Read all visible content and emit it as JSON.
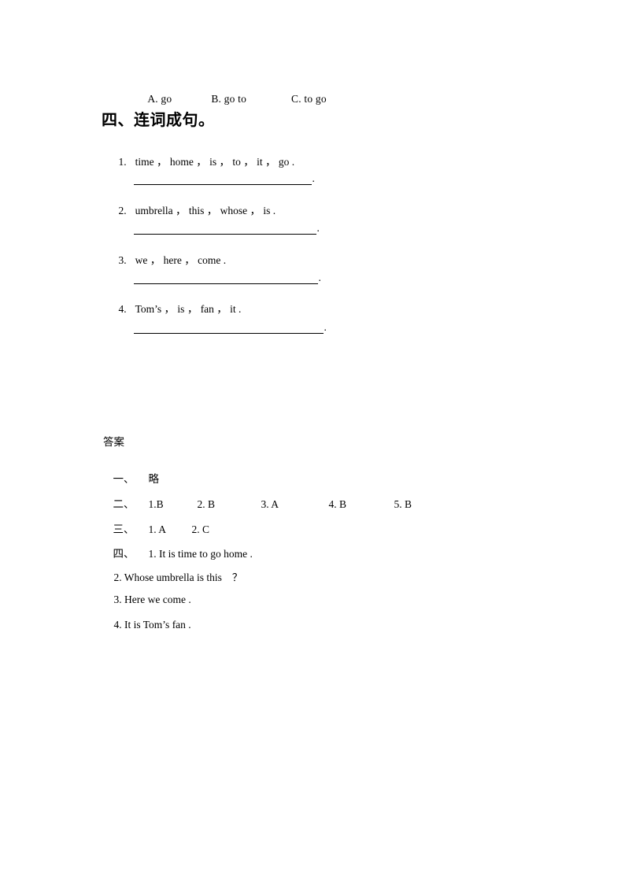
{
  "document": {
    "type": "worksheet",
    "language": "zh-CN + en"
  },
  "multiple_choice_options": {
    "option_a": "A. go",
    "option_b": "B. go to",
    "option_c": "C. to go"
  },
  "section_four": {
    "heading": "四、连词成句。",
    "items": [
      {
        "number": "1.",
        "words": "time ， home ， is ， to ， it ， go ."
      },
      {
        "number": "2.",
        "words": "umbrella ， this ， whose ， is ."
      },
      {
        "number": "3.",
        "words": "we ， here ， come ."
      },
      {
        "number": "4.",
        "words": "Tom’s ， is ， fan ， it ."
      }
    ],
    "blank_terminator": "."
  },
  "answer_key": {
    "title": "答案",
    "row_one": {
      "label": "一、",
      "value": "略"
    },
    "row_two": {
      "label": "二、",
      "answers": [
        "1.B",
        "2. B",
        "3. A",
        "4. B",
        "5. B"
      ]
    },
    "row_three": {
      "label": "三、",
      "answers": [
        "1. A",
        "2. C"
      ]
    },
    "row_four": {
      "label": "四、",
      "answers": [
        "1. It is time to go home .",
        "2. Whose umbrella is this",
        "3. Here we come .",
        "4. It is Tom’s fan ."
      ],
      "question_mark": "？"
    }
  }
}
